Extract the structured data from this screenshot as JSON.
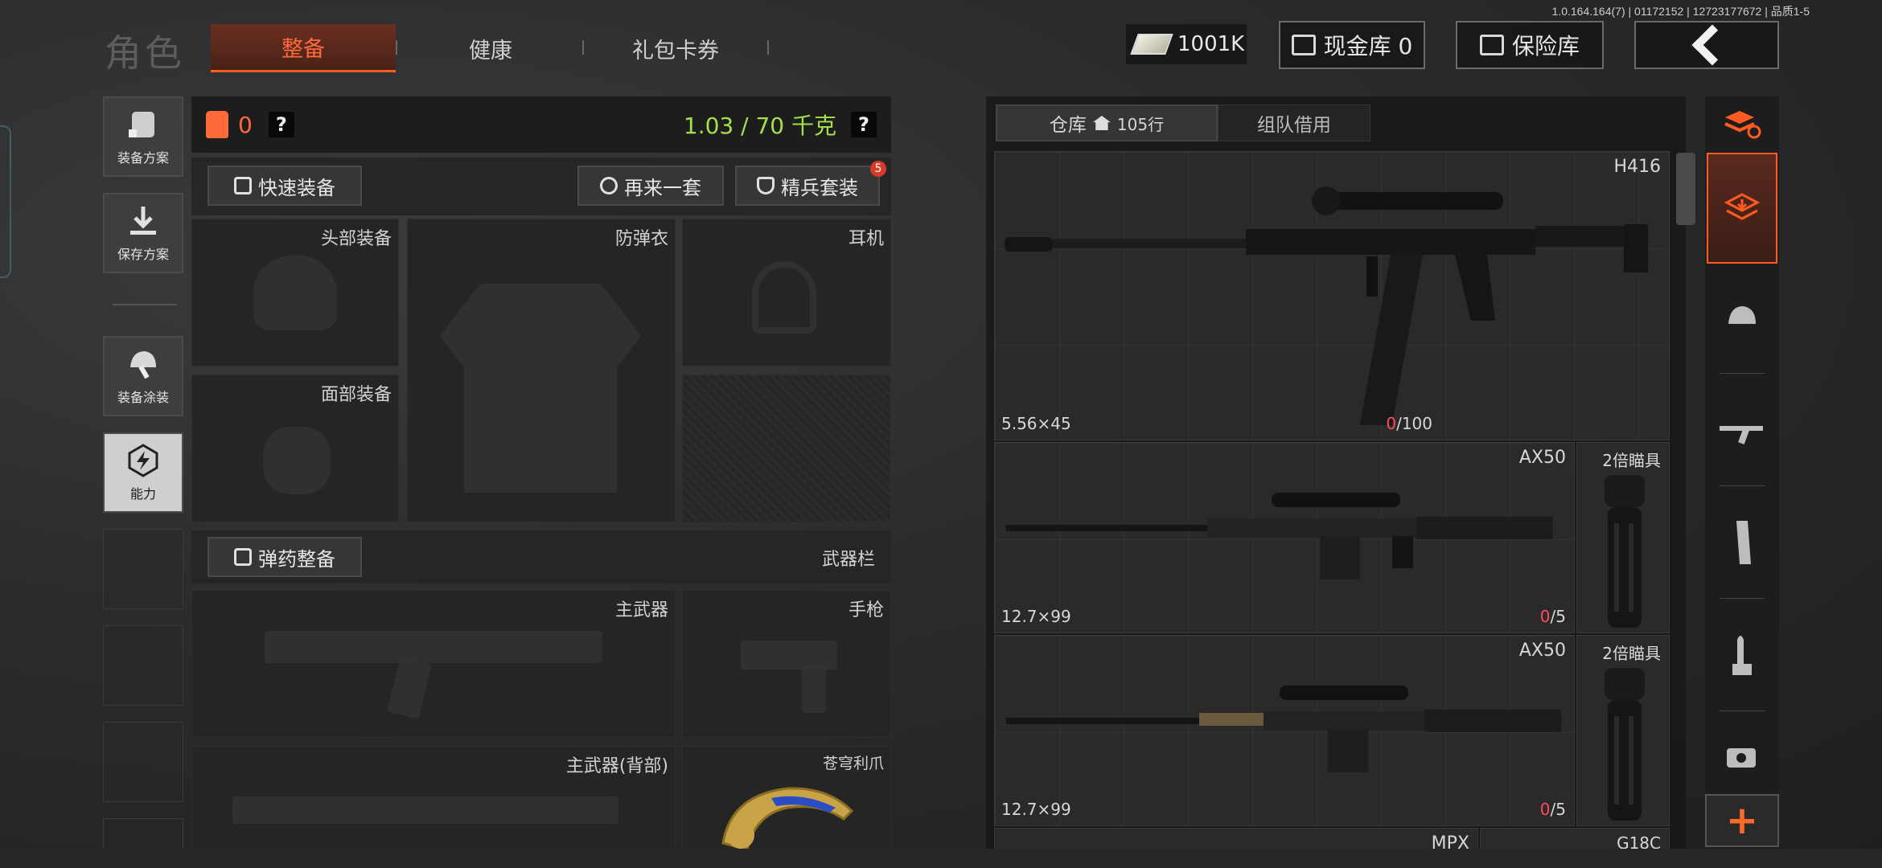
{
  "version": "1.0.164.164(7) | 01172152 | 12723177672 | 品质1-5",
  "header": {
    "role_title": "角色",
    "tabs": [
      "整备",
      "健康",
      "礼包卡券"
    ],
    "money": "1001K",
    "cash_vault": "现金库 0",
    "safe": "保险库"
  },
  "left_nav": [
    "装备方案",
    "保存方案",
    "装备涂装",
    "能力"
  ],
  "equipment": {
    "armor_count": "0",
    "weight": "1.03 / 70 千克",
    "quick_equip": "快速装备",
    "reroll": "再来一套",
    "elite_set": "精兵套装",
    "elite_badge": "5",
    "slots": {
      "head": "头部装备",
      "vest": "防弹衣",
      "headset": "耳机",
      "face": "面部装备",
      "primary": "主武器",
      "pistol": "手枪",
      "primary_back": "主武器(背部)",
      "melee": "苍穹利爪"
    },
    "ammo_prep": "弹药整备",
    "weapon_bar": "武器栏"
  },
  "warehouse": {
    "tab_storage": "仓库",
    "rows": "105行",
    "tab_team": "组队借用",
    "items": [
      {
        "name": "H416",
        "caliber": "5.56×45",
        "dur_cur": "0",
        "dur_max": "/100"
      },
      {
        "name": "AX50",
        "caliber": "12.7×99",
        "dur_cur": "0",
        "dur_max": "/5",
        "scope": "2倍瞄具"
      },
      {
        "name": "AX50",
        "caliber": "12.7×99",
        "dur_cur": "0",
        "dur_max": "/5",
        "scope": "2倍瞄具"
      },
      {
        "name": "MPX",
        "scope": "G18C"
      }
    ]
  },
  "icons": [
    "money-icon",
    "cash-vault-icon",
    "safe-icon",
    "back-arrow-icon",
    "armor-icon",
    "shirt-icon",
    "refresh-icon",
    "shield-icon",
    "house-icon",
    "plus-icon"
  ],
  "colors": {
    "accent": "#ff5a22",
    "weight": "#a3e04a",
    "durability": "#ff4a5a"
  }
}
